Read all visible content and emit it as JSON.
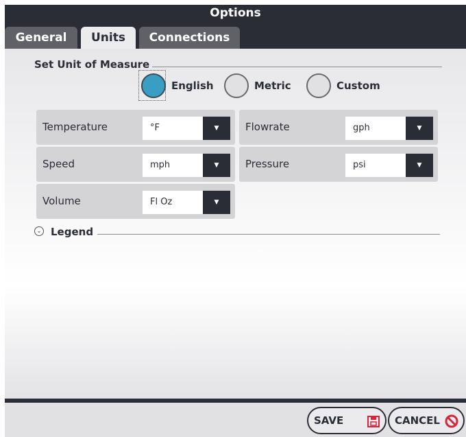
{
  "window": {
    "title": "Options"
  },
  "tabs": [
    {
      "label": "General",
      "active": false
    },
    {
      "label": "Units",
      "active": true
    },
    {
      "label": "Connections",
      "active": false
    }
  ],
  "unit_of_measure": {
    "section_title": "Set Unit of Measure",
    "options": [
      {
        "label": "English",
        "selected": true
      },
      {
        "label": "Metric",
        "selected": false
      },
      {
        "label": "Custom",
        "selected": false
      }
    ]
  },
  "units": {
    "temperature": {
      "label": "Temperature",
      "value": "°F"
    },
    "flowrate": {
      "label": "Flowrate",
      "value": "gph"
    },
    "speed": {
      "label": "Speed",
      "value": "mph"
    },
    "pressure": {
      "label": "Pressure",
      "value": "psi"
    },
    "volume": {
      "label": "Volume",
      "value": "Fl Oz"
    }
  },
  "legend": {
    "title": "Legend",
    "expanded": false
  },
  "buttons": {
    "save": "SAVE",
    "cancel": "CANCEL"
  },
  "colors": {
    "dark": "#2a2c36",
    "selected_radio": "#3a9ec3",
    "save_icon": "#d9243a",
    "cancel_icon": "#d9243a"
  }
}
